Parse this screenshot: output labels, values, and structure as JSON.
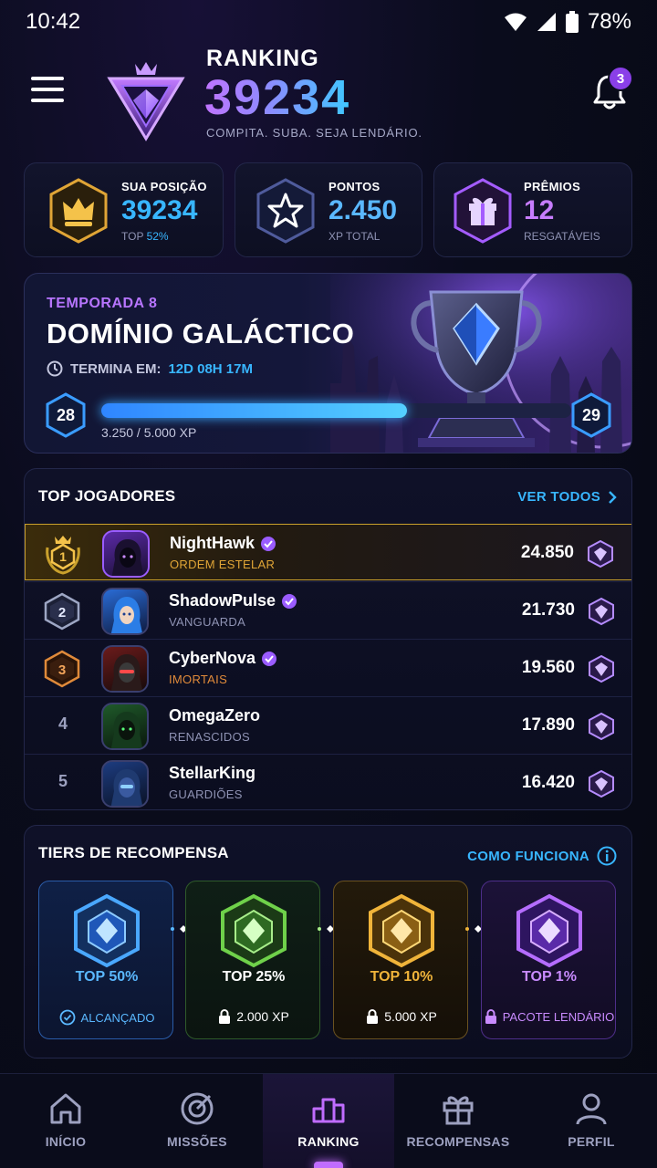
{
  "status_bar": {
    "time": "10:42",
    "battery": "78%"
  },
  "header": {
    "title": "RANKING",
    "rank_number": "39234",
    "tagline": "COMPITA. SUBA. SEJA LENDÁRIO.",
    "notification_count": "3"
  },
  "stats": [
    {
      "label": "SUA POSIÇÃO",
      "value": "39234",
      "sub_prefix": "TOP ",
      "sub_highlight": "52%",
      "color": "#38b6ff"
    },
    {
      "label": "PONTOS",
      "value": "2.450",
      "sub": "XP TOTAL",
      "color": "#5ab8ff"
    },
    {
      "label": "PRÊMIOS",
      "value": "12",
      "sub": "RESGATÁVEIS",
      "color": "#c77dff"
    }
  ],
  "season": {
    "label": "TEMPORADA 8",
    "title": "DOMÍNIO GALÁCTICO",
    "timer_label": "TERMINA EM:",
    "timer_value": "12D 08H 17M",
    "level_current": "28",
    "level_next": "29",
    "xp_text": "3.250 / 5.000 XP",
    "progress": 0.65
  },
  "top_players": {
    "title": "TOP JOGADORES",
    "link": "VER TODOS",
    "rows": [
      {
        "rank": "1",
        "name": "NightHawk",
        "clan": "ORDEM ESTELAR",
        "score": "24.850",
        "verified": true,
        "clan_color": "#e0a536"
      },
      {
        "rank": "2",
        "name": "ShadowPulse",
        "clan": "VANGUARDA",
        "score": "21.730",
        "verified": true,
        "clan_color": "#8f93b4"
      },
      {
        "rank": "3",
        "name": "CyberNova",
        "clan": "IMORTAIS",
        "score": "19.560",
        "verified": true,
        "clan_color": "#e08a3a"
      },
      {
        "rank": "4",
        "name": "OmegaZero",
        "clan": "RENASCIDOS",
        "score": "17.890",
        "verified": false,
        "clan_color": "#8f93b4"
      },
      {
        "rank": "5",
        "name": "StellarKing",
        "clan": "GUARDIÕES",
        "score": "16.420",
        "verified": false,
        "clan_color": "#8f93b4"
      }
    ]
  },
  "tiers": {
    "title": "TIERS DE RECOMPENSA",
    "link": "COMO FUNCIONA",
    "items": [
      {
        "name": "TOP 50%",
        "foot": "ALCANÇADO",
        "state": "achieved",
        "color": "#3fa3ff"
      },
      {
        "name": "TOP 25%",
        "foot": "2.000 XP",
        "state": "locked",
        "color": "#6fd14a"
      },
      {
        "name": "TOP 10%",
        "foot": "5.000 XP",
        "state": "locked",
        "color": "#f0b43a"
      },
      {
        "name": "TOP 1%",
        "foot": "PACOTE LENDÁRIO",
        "state": "locked",
        "color": "#b56dff"
      }
    ]
  },
  "nav": {
    "items": [
      {
        "label": "INÍCIO"
      },
      {
        "label": "MISSÕES"
      },
      {
        "label": "RANKING"
      },
      {
        "label": "RECOMPENSAS"
      },
      {
        "label": "PERFIL"
      }
    ],
    "active_index": 2
  }
}
